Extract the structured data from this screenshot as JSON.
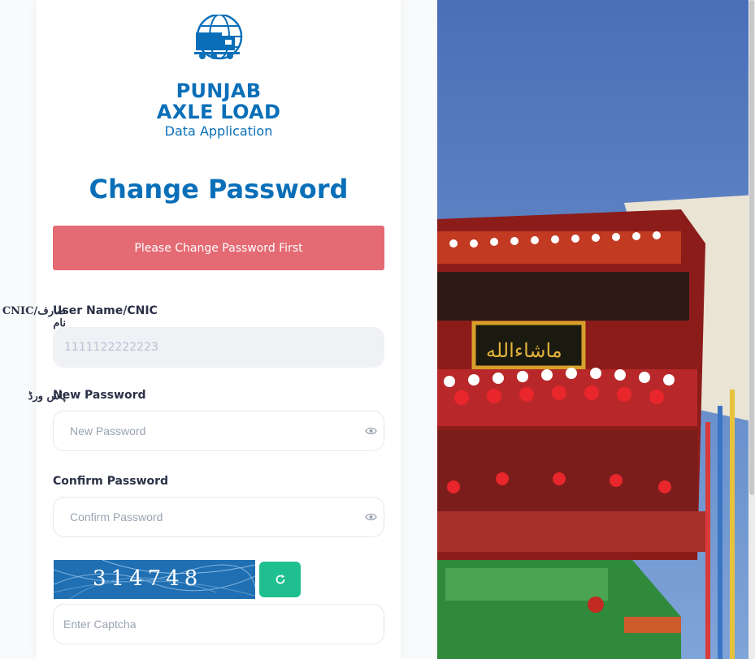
{
  "brand": {
    "line1": "PUNJAB",
    "line2": "AXLE LOAD",
    "subtitle": "Data Application",
    "logo_icon": "truck-globe-icon"
  },
  "page": {
    "title": "Change Password"
  },
  "alert": {
    "message": "Please Change Password First",
    "color": "#e46a74"
  },
  "form": {
    "username": {
      "label": "User Name/CNIC",
      "label_urdu": "CNIC/صارف نام",
      "value": "1111122222223"
    },
    "new_password": {
      "label": "New Password",
      "label_urdu": "پاس ورڈ",
      "placeholder": "New Password"
    },
    "confirm_password": {
      "label": "Confirm Password",
      "placeholder": "Confirm Password"
    },
    "captcha": {
      "text": "314748",
      "placeholder": "Enter Captcha",
      "refresh_icon": "refresh-icon"
    }
  },
  "colors": {
    "brand_blue": "#0a6fb8",
    "refresh_green": "#1fbf8f"
  }
}
